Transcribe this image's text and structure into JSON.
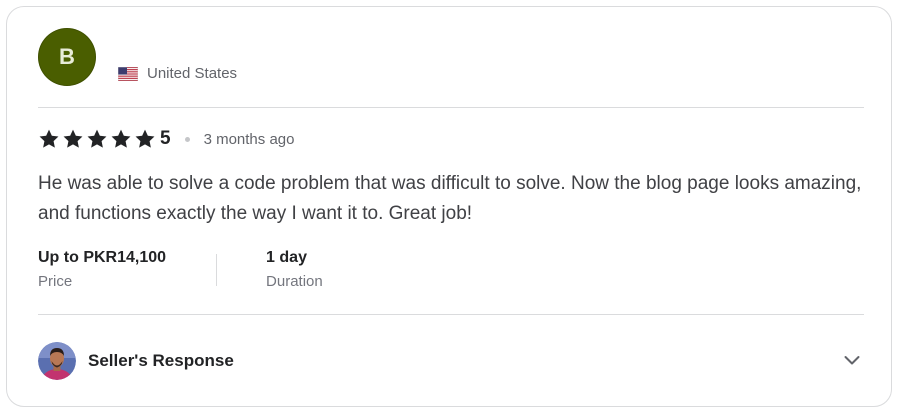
{
  "reviewer": {
    "initial": "B",
    "avatar_color": "#4a5e00",
    "country": "United States",
    "flag_icon": "us-flag-icon"
  },
  "rating": {
    "stars": 5,
    "value": "5",
    "time_ago": "3 months ago"
  },
  "review": {
    "text": "He was able to solve a code problem that was difficult to solve. Now the blog page looks amazing, and functions exactly the way I want it to. Great job!"
  },
  "details": {
    "price": {
      "value": "Up to PKR14,100",
      "label": "Price"
    },
    "duration": {
      "value": "1 day",
      "label": "Duration"
    }
  },
  "seller_response": {
    "label": "Seller's Response",
    "toggle_icon": "chevron-down-icon"
  },
  "colors": {
    "text_primary": "#222325",
    "text_secondary": "#62646a",
    "border": "#dadbdd",
    "star": "#222325"
  }
}
